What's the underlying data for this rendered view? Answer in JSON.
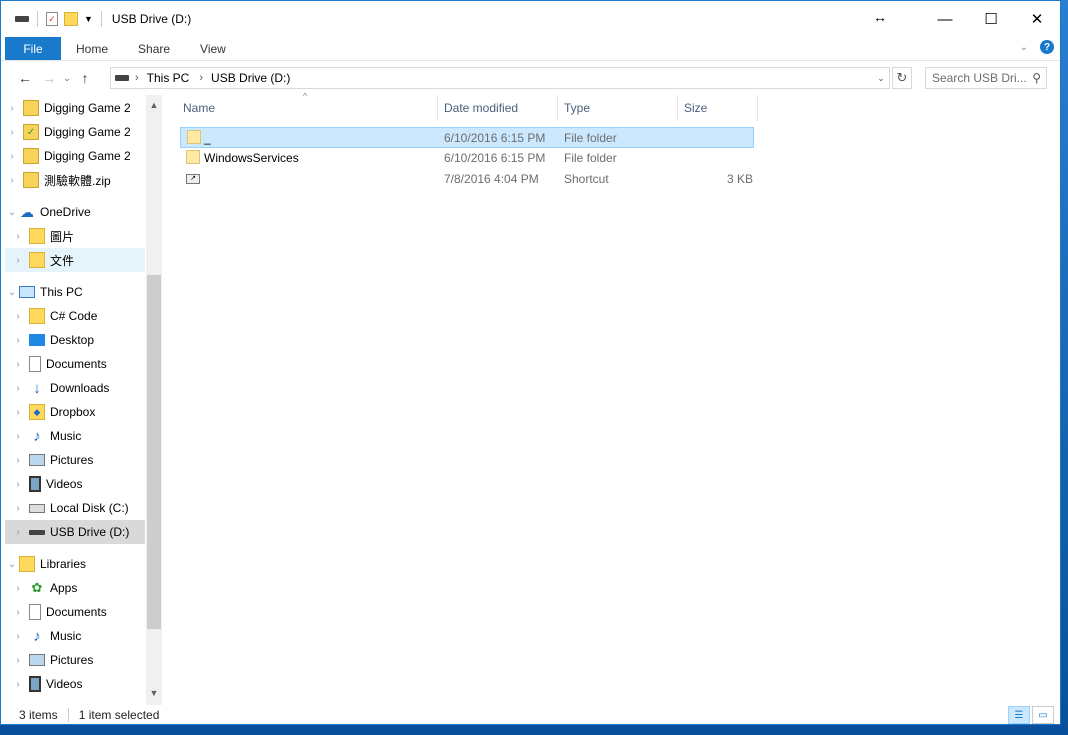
{
  "window": {
    "title": "USB Drive (D:)",
    "controls": {
      "minimize": "—",
      "maximize": "☐",
      "close": "✕"
    }
  },
  "ribbon": {
    "tabs": [
      "File",
      "Home",
      "Share",
      "View"
    ],
    "help": "?"
  },
  "address": {
    "crumbs": [
      "This PC",
      "USB Drive (D:)"
    ],
    "search_placeholder": "Search USB Dri..."
  },
  "nav": {
    "items": [
      {
        "label": "Digging Game 2",
        "icon": "zip-icon"
      },
      {
        "label": "Digging Game 2",
        "icon": "zip-check-icon"
      },
      {
        "label": "Digging Game 2",
        "icon": "zip-icon"
      },
      {
        "label": "測驗軟體.zip",
        "icon": "zip-icon"
      },
      {
        "label": "OneDrive",
        "icon": "cloud-icon"
      },
      {
        "label": "圖片",
        "icon": "folder-icon"
      },
      {
        "label": "文件",
        "icon": "folder-icon"
      },
      {
        "label": "This PC",
        "icon": "computer-icon"
      },
      {
        "label": "C# Code",
        "icon": "folder-icon"
      },
      {
        "label": "Desktop",
        "icon": "desktop-icon"
      },
      {
        "label": "Documents",
        "icon": "document-icon"
      },
      {
        "label": "Downloads",
        "icon": "download-icon"
      },
      {
        "label": "Dropbox",
        "icon": "dropbox-icon"
      },
      {
        "label": "Music",
        "icon": "music-icon"
      },
      {
        "label": "Pictures",
        "icon": "picture-icon"
      },
      {
        "label": "Videos",
        "icon": "video-icon"
      },
      {
        "label": "Local Disk (C:)",
        "icon": "disk-icon"
      },
      {
        "label": "USB Drive (D:)",
        "icon": "usb-icon"
      },
      {
        "label": "Libraries",
        "icon": "library-icon"
      },
      {
        "label": "Apps",
        "icon": "apps-icon"
      },
      {
        "label": "Documents",
        "icon": "document-icon"
      },
      {
        "label": "Music",
        "icon": "music-icon"
      },
      {
        "label": "Pictures",
        "icon": "picture-icon"
      },
      {
        "label": "Videos",
        "icon": "video-icon"
      }
    ]
  },
  "columns": [
    "Name",
    "Date modified",
    "Type",
    "Size"
  ],
  "files": [
    {
      "name": "_",
      "date": "6/10/2016 6:15 PM",
      "type": "File folder",
      "size": "",
      "icon": "folder-icon"
    },
    {
      "name": "WindowsServices",
      "date": "6/10/2016 6:15 PM",
      "type": "File folder",
      "size": "",
      "icon": "folder-icon"
    },
    {
      "name": "",
      "date": "7/8/2016 4:04 PM",
      "type": "Shortcut",
      "size": "3 KB",
      "icon": "shortcut-icon"
    }
  ],
  "status": {
    "count": "3 items",
    "selection": "1 item selected"
  }
}
